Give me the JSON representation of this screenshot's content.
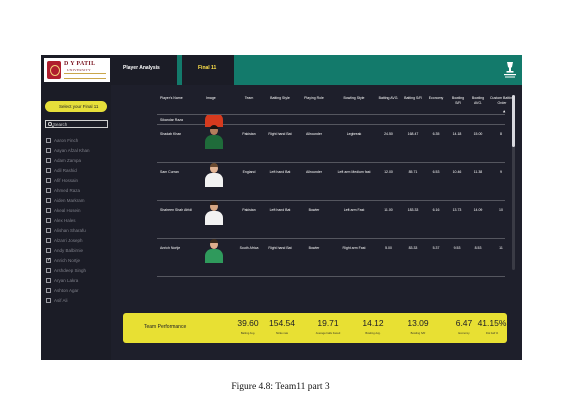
{
  "header": {
    "logo": {
      "name": "D Y PATIL",
      "sub": "UNIVERSITY"
    },
    "tab_analysis": "Player Analysis",
    "tab_final": "Final 11"
  },
  "sidebar": {
    "select_label": "Select your Final 11",
    "search_placeholder": "Search",
    "players": [
      {
        "name": "Aaron Finch",
        "checked": false
      },
      {
        "name": "Aayan Afzal Khan",
        "checked": false
      },
      {
        "name": "Adam Zampa",
        "checked": false
      },
      {
        "name": "Adil Rashid",
        "checked": false
      },
      {
        "name": "Afif Hossain",
        "checked": false
      },
      {
        "name": "Ahmed Raza",
        "checked": false
      },
      {
        "name": "Aiden Markram",
        "checked": false
      },
      {
        "name": "Akeal Hosein",
        "checked": false
      },
      {
        "name": "Alex Hales",
        "checked": false
      },
      {
        "name": "Alishan Sharafu",
        "checked": false
      },
      {
        "name": "Alzarri Joseph",
        "checked": false
      },
      {
        "name": "Andy Balbirnie",
        "checked": false
      },
      {
        "name": "Anrich Nortje",
        "checked": true
      },
      {
        "name": "Arshdeep Singh",
        "checked": false
      },
      {
        "name": "Aryan Lakra",
        "checked": false
      },
      {
        "name": "Ashton Agar",
        "checked": false
      },
      {
        "name": "Asif Ali",
        "checked": false
      }
    ]
  },
  "table": {
    "headers": {
      "name": "Player's Name",
      "image": "Image",
      "team": "Team",
      "batting_style": "Batting Style",
      "playing_role": "Playing Role",
      "bowling_style": "Bowling Style",
      "batting_avg": "Batting AVG.",
      "batting_sr": "Batting S/R",
      "economy": "Economy",
      "bowling_sr": "Bowling S/R",
      "bowling_avg": "Bowling AVG.",
      "custom_order": "Custom Batting Order"
    },
    "rows": [
      {
        "name": "Sikandar Raza",
        "team": "",
        "batting_style": "",
        "playing_role": "",
        "bowling_style": "",
        "batting_avg": "",
        "batting_sr": "",
        "economy": "",
        "bowling_sr": "",
        "bowling_avg": "",
        "order": "",
        "jersey": "#d63a1e",
        "skin": "#b9795a",
        "hair": "#241812"
      },
      {
        "name": "Shadab Khan",
        "team": "Pakistan",
        "batting_style": "Right hand Bat",
        "playing_role": "Allrounder",
        "bowling_style": "Legbreak",
        "batting_avg": "24.50",
        "batting_sr": "168.47",
        "economy": "6.35",
        "bowling_sr": "14.18",
        "bowling_avg": "15.00",
        "order": "8",
        "jersey": "#1f6b3a",
        "skin": "#b57d5c",
        "hair": "#1a1410"
      },
      {
        "name": "Sam Curran",
        "team": "England",
        "batting_style": "Left hand Bat",
        "playing_role": "Allrounder",
        "bowling_style": "Left arm Medium fast",
        "batting_avg": "12.00",
        "batting_sr": "85.71",
        "economy": "6.53",
        "bowling_sr": "10.46",
        "bowling_avg": "11.38",
        "order": "9",
        "jersey": "#f2f2f2",
        "skin": "#e3b596",
        "hair": "#6a4a30"
      },
      {
        "name": "Shaheen Shah Afridi",
        "team": "Pakistan",
        "batting_style": "Left hand Bat",
        "playing_role": "Bowler",
        "bowling_style": "Left arm Fast",
        "batting_avg": "11.00",
        "batting_sr": "183.33",
        "economy": "6.16",
        "bowling_sr": "13.73",
        "bowling_avg": "14.09",
        "order": "10",
        "jersey": "#f2f2f2",
        "skin": "#d7a683",
        "hair": "#2a1c14"
      },
      {
        "name": "Anrich Nortje",
        "team": "South Africa",
        "batting_style": "Right hand Bat",
        "playing_role": "Bowler",
        "bowling_style": "Right arm Fast",
        "batting_avg": "5.00",
        "batting_sr": "83.33",
        "economy": "5.37",
        "bowling_sr": "9.53",
        "bowling_avg": "8.53",
        "order": "11",
        "jersey": "#2f9a5c",
        "skin": "#e0ae8c",
        "hair": "#3a2a1c"
      }
    ]
  },
  "performance": {
    "label": "Team Performance",
    "kpis": [
      {
        "value": "39.60",
        "label": "Batting Avg."
      },
      {
        "value": "154.54",
        "label": "Strike rate"
      },
      {
        "value": "19.71",
        "label": "Average balls Faced"
      },
      {
        "value": "14.12",
        "label": "Bowling Avg."
      },
      {
        "value": "13.09",
        "label": "Bowling S/R"
      },
      {
        "value": "6.47",
        "label": "Economy"
      },
      {
        "value": "41.15%",
        "label": "Dot ball %"
      }
    ]
  },
  "caption": "Figure 4.8: Team11 part 3"
}
